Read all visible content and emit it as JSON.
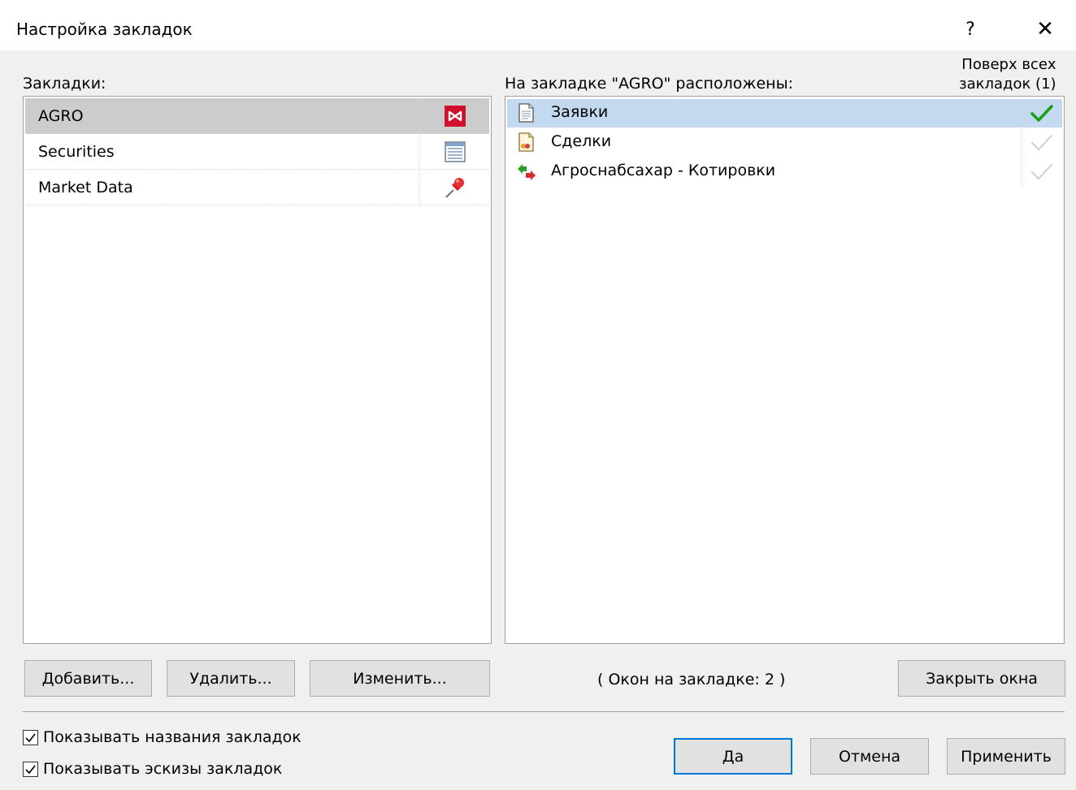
{
  "window": {
    "title": "Настройка закладок",
    "help_glyph": "?",
    "close_glyph": "✕"
  },
  "left": {
    "label": "Закладки:",
    "items": [
      {
        "label": "AGRO",
        "icon": "moex-logo-icon",
        "selected": true
      },
      {
        "label": "Securities",
        "icon": "table-icon",
        "selected": false
      },
      {
        "label": "Market Data",
        "icon": "pushpin-icon",
        "selected": false
      }
    ],
    "buttons": {
      "add": "Добавить...",
      "delete": "Удалить...",
      "edit": "Изменить..."
    }
  },
  "right": {
    "label": "На закладке \"AGRO\" расположены:",
    "on_top_header_line1": "Поверх всех",
    "on_top_header_line2": "закладок (1)",
    "items": [
      {
        "label": "Заявки",
        "icon": "document-icon",
        "on_top": true,
        "selected": true
      },
      {
        "label": "Сделки",
        "icon": "deals-document-icon",
        "on_top": false,
        "selected": false
      },
      {
        "label": "Агроснабсахар - Котировки",
        "icon": "quotes-arrows-icon",
        "on_top": false,
        "selected": false
      }
    ],
    "window_count_text": "( Окон на закладке: 2 )",
    "close_windows_button": "Закрыть окна"
  },
  "options": {
    "show_names": {
      "label": "Показывать названия закладок",
      "checked": true
    },
    "show_thumbnails": {
      "label": "Показывать эскизы закладок",
      "checked": true
    }
  },
  "footer": {
    "ok": "Да",
    "cancel": "Отмена",
    "apply": "Применить"
  },
  "colors": {
    "selection_blue": "#c2d9f0",
    "selection_gray": "#cccccc",
    "check_green": "#1a9e1a",
    "default_button_border": "#0078d7"
  }
}
